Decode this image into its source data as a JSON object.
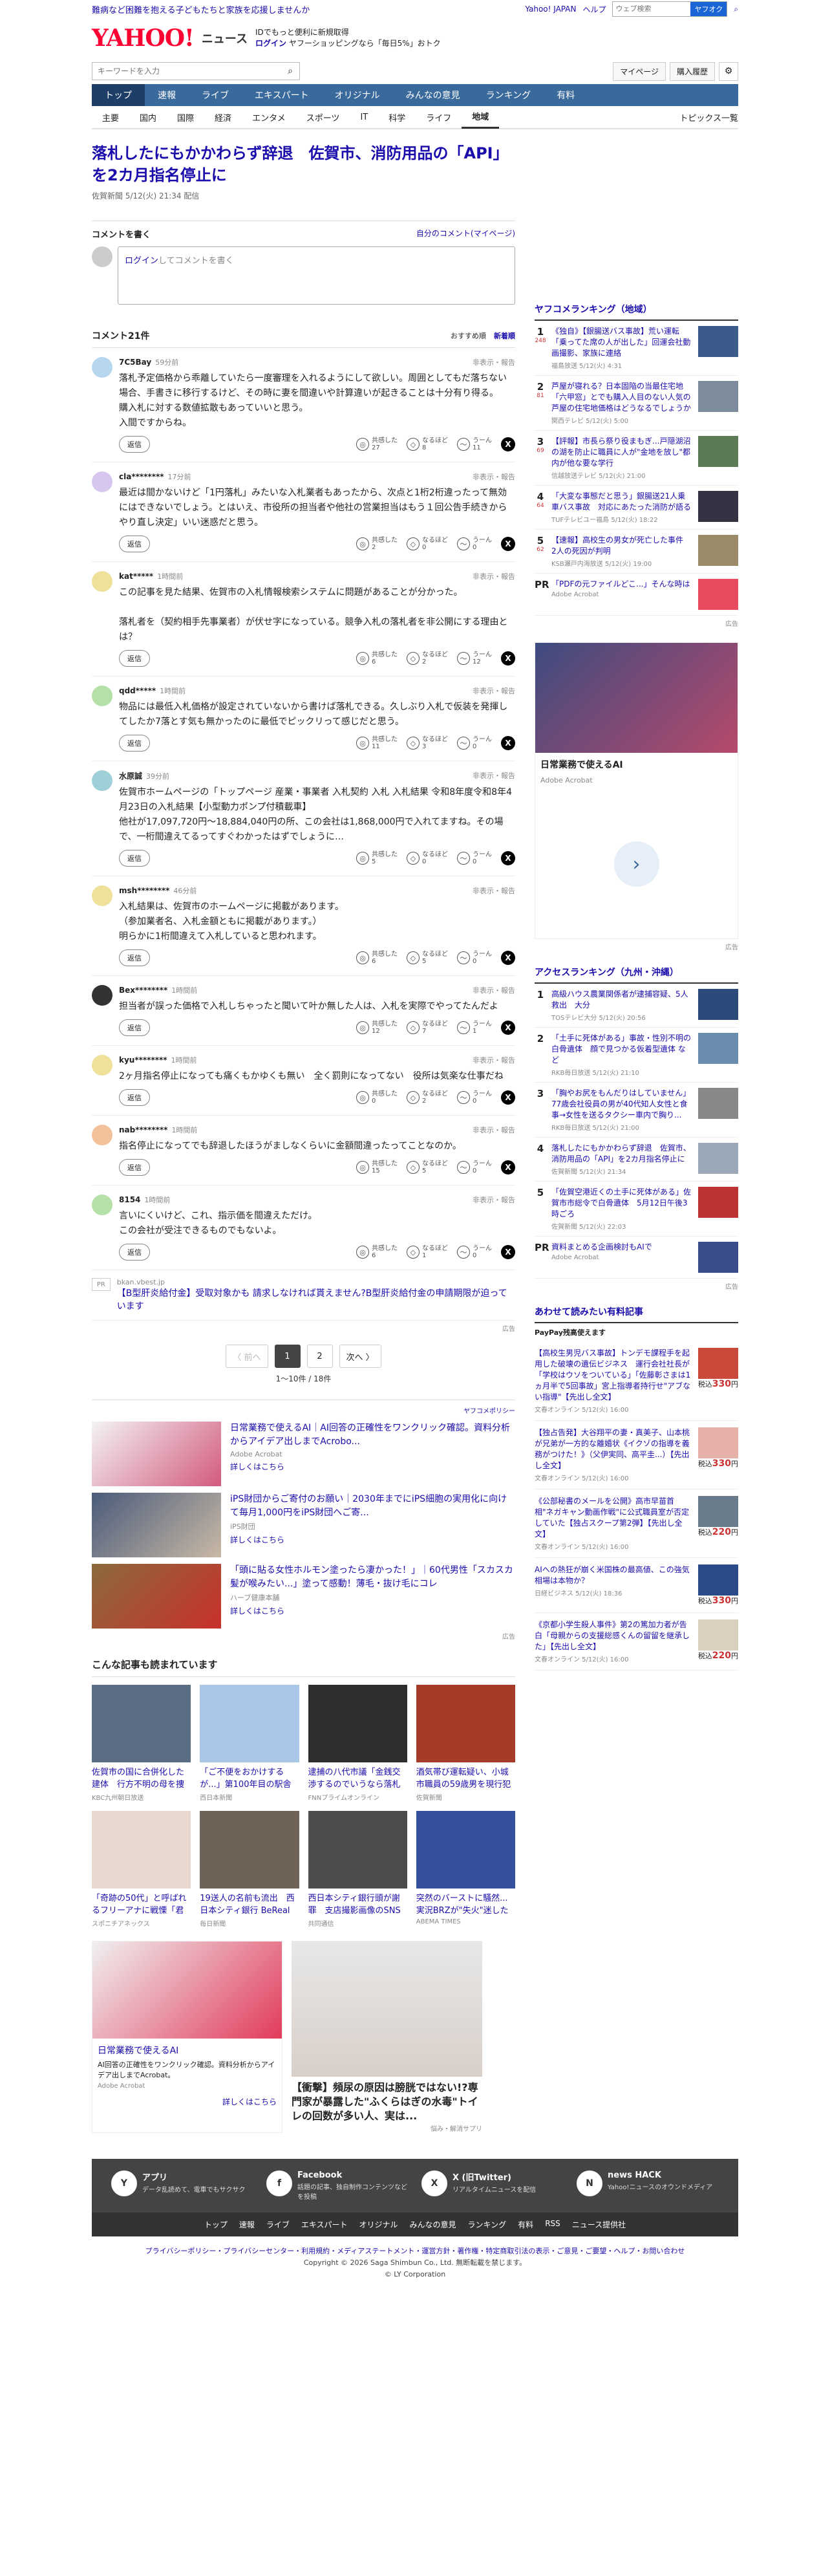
{
  "topbar": {
    "promo": "難病など困難を抱える子どもたちと家族を応援しませんか",
    "links": [
      "Yahoo! JAPAN",
      "ヘルプ"
    ],
    "search_placeholder": "ウェブ検索",
    "search_label": "ヤフオク"
  },
  "logo": {
    "brand": "YAHOO!",
    "sub": "ニュース",
    "line1": "IDでもっと便利に新規取得",
    "login": "ログイン",
    "line2": "ヤフーショッピングなら「毎日5%」おトク"
  },
  "search": {
    "placeholder": "キーワードを入力",
    "mypage": "マイページ",
    "purchase": "購入履歴"
  },
  "gnav": [
    "トップ",
    "速報",
    "ライブ",
    "エキスパート",
    "オリジナル",
    "みんなの意見",
    "ランキング",
    "有料"
  ],
  "subnav": {
    "items": [
      "主要",
      "国内",
      "国際",
      "経済",
      "エンタメ",
      "スポーツ",
      "IT",
      "科学",
      "ライフ",
      "地域"
    ],
    "toplink": "トピックス一覧"
  },
  "article": {
    "title": "落札したにもかかわらず辞退　佐賀市、消防用品の「API」を2カ月指名停止に",
    "source": "佐賀新聞",
    "time": "5/12(火) 21:34 配信"
  },
  "comment_box": {
    "title": "コメントを書く",
    "mine": "自分のコメント(マイページ)",
    "login": "ログイン",
    "placeholder": "してコメントを書く"
  },
  "comments_head": {
    "title": "コメント21件",
    "sort1": "おすすめ順",
    "sort2": "新着順"
  },
  "reactions": [
    "共感した",
    "なるほど",
    "うーん"
  ],
  "comments": [
    {
      "user": "7C5Bay",
      "time": "59分前",
      "text": "落札予定価格から乖離していたら一度審理を入れるようにして欲しい。周囲としてもだ落ちない場合、手書きに移行するけど、その時に妻を間違いや計算違いが起きることは十分有り得る。\n購入札に対する数値拡散もあっていいと思う。\n入間ですからね。",
      "c1": "27",
      "c2": "8",
      "c3": "11",
      "color": "#b7d7ef"
    },
    {
      "user": "cla********",
      "time": "17分前",
      "text": "最近は間かないけど「1円落札」みたいな入札業者もあったから、次点と1桁2桁違ったって無効にはできないでしょう。とはいえ、市役所の担当者や他社の営業担当はもう１回公告手続きからやり直し決定」いい迷惑だと思う。",
      "c1": "2",
      "c2": "0",
      "c3": "0",
      "color": "#d7c7ef"
    },
    {
      "user": "kat*****",
      "time": "1時間前",
      "text": "この記事を見た結果、佐賀市の入札情報検索システムに問題があることが分かった。\n\n落札者を（契約相手先事業者）が伏せ字になっている。競争入札の落札者を非公開にする理由とは？",
      "c1": "6",
      "c2": "2",
      "c3": "12",
      "color": "#efe09a"
    },
    {
      "user": "qdd*****",
      "time": "1時間前",
      "text": "物品には最低入札価格が設定されていないから書けば落札できる。久しぶり入札で仮装を発揮してしたか7落とす気も無かったのに最低でピックリって感じだと思う。",
      "c1": "11",
      "c2": "3",
      "c3": "0",
      "color": "#b5e0a8"
    },
    {
      "user": "水原誠",
      "time": "39分前",
      "text": "佐賀市ホームページの「トップページ 産業・事業者 入札契約 入札 入札結果 令和8年度令和8年4月23日の入札結果【小型動力ポンプ付積載車】\n他社が17,097,720円〜18,884,040円の所、この会社は1,868,000円で入れてますね。その場で、一桁間違えてるってすぐわかったはずでしょうに…",
      "c1": "5",
      "c2": "0",
      "c3": "0",
      "color": "#9fd0d8"
    },
    {
      "user": "msh********",
      "time": "46分前",
      "text": "入札結果は、佐賀市のホームページに掲載があります。\n（参加業者名、入札金額ともに掲載があります。）\n明らかに1桁間違えて入札していると思われます。",
      "c1": "6",
      "c2": "5",
      "c3": "0",
      "color": "#efe09a"
    },
    {
      "user": "Bex********",
      "time": "1時間前",
      "text": "担当者が誤った価格で入札しちゃったと聞いて叶か無した人は、入札を実際でやってたんだよ",
      "c1": "12",
      "c2": "7",
      "c3": "1",
      "color": "#333333"
    },
    {
      "user": "kyu********",
      "time": "1時間前",
      "text": "2ヶ月指名停止になっても痛くもかゆくも無い　全く罰則になってない　役所は気楽な仕事だね",
      "c1": "0",
      "c2": "2",
      "c3": "0",
      "color": "#efe09a"
    },
    {
      "user": "nab********",
      "time": "1時間前",
      "text": "指名停止になってでも辞退したほうがましなくらいに金額間違ったってことなのか。",
      "c1": "15",
      "c2": "5",
      "c3": "0",
      "color": "#f3c29c"
    },
    {
      "user": "8154",
      "time": "1時間前",
      "text": "言いにくいけど、これ、指示価を間違えただけ。\nこの会社が受注できるものでもないよ。",
      "c1": "6",
      "c2": "1",
      "c3": "0",
      "color": "#b5e0a8"
    }
  ],
  "reply_label": "返信",
  "report_label": "非表示・報告",
  "pr_comment": {
    "tag": "PR",
    "src": "bkan.vbest.jp",
    "text": "【B型肝炎給付金】受取対象かも 請求しなければ貰えません?B型肝炎給付金の申請期限が迫っています"
  },
  "ad_tag": "広告",
  "pager": {
    "prev": "〈 前へ",
    "pages": [
      "1",
      "2"
    ],
    "next": "次へ 〉",
    "info": "1〜10件 / 18件"
  },
  "ads": {
    "policy": "ヤフコメポリシー",
    "items": [
      {
        "title": "日常業務で使えるAI｜AI回答の正確性をワンクリック確認。資料分析からアイデア出しまでAcrobo...",
        "src": "Adobe Acrobat",
        "more": "詳しくはこちら"
      },
      {
        "title": "iPS財団からご寄付のお願い｜2030年までにiPS細胞の実用化に向けて毎月1,000円をiPS財団へご寄...",
        "src": "iPS財団",
        "more": "詳しくはこちら"
      },
      {
        "title": "「頭に貼る女性ホルモン塗ったら凄かった！」｜60代男性「スカスカ髪が喉みたい...」塗って感動！薄毛・抜け毛にコレ",
        "src": "ハーブ健康本舗",
        "more": "詳しくはこちら"
      }
    ]
  },
  "read_also": {
    "title": "こんな記事も読まれています",
    "items": [
      {
        "title": "佐賀市の国に合併化した建体　行方不明の母を捜索中",
        "src": "KBC九州朝日放送"
      },
      {
        "title": "「ご不便をおかけするが...」第100年目の駅舎が利用中止に　老...",
        "src": "西日本新聞"
      },
      {
        "title": "逮捕の八代市議「金銭交渉するのでいうなら落札して」行き違め...",
        "src": "FNNプライムオンライン"
      },
      {
        "title": "酒気帯び運転疑い、小城市職員の59歳男を現行犯逮捕　佐賀市の...",
        "src": "佐賀新聞"
      },
      {
        "title": "「奇跡の50代」と呼ばれるフリーアナに戦慄「君なるような、だん...",
        "src": "スポニチアネックス"
      },
      {
        "title": "19送人の名前も流出　西日本シティ銀行 BeReal 投稿問題",
        "src": "毎日新聞"
      },
      {
        "title": "西日本シティ銀行頭が謝罪　支店撮影画像のSNS拡散",
        "src": "共同通信"
      },
      {
        "title": "突然のバーストに騒然...実況BRZが\"失火\"迷した事態を「重...",
        "src": "ABEMA TIMES"
      }
    ]
  },
  "bottom_ads": {
    "a1_title": "日常業務で使えるAI",
    "a1_desc": "AI回答の正確性をワンクリック確認。資料分析からアイデア出しまでAcrobat。",
    "a1_src": "Adobe Acrobat",
    "a1_more": "詳しくはこちら",
    "a2_title": "【衝撃】頻尿の原因は膀胱ではない!?専門家が暴露した\"ふくらはぎの水毒\"トイレの回数が多い人、実は...",
    "a2_src": "悩み・解消サプリ"
  },
  "side": {
    "rank_title": "ヤフコメランキング（地域）",
    "rank": [
      {
        "n": "1",
        "c": "248",
        "t": "《独自》【銀腸送バス事故】荒い運転「乗ってた席の人が出した」回運会社動画撮影、家族に連絡",
        "src": "福島放送 5/12(火) 4:31"
      },
      {
        "n": "2",
        "c": "81",
        "t": "芦屋が寝れる？日本固陥の当最住宅地「六甲窓」とでも購入人目のない人気の芦屋の住宅地価格はどうなるでしょうか",
        "src": "関西テレビ 5/12(火) 5:00"
      },
      {
        "n": "3",
        "c": "69",
        "t": "【評報】市長ら祭り役まもぎ...戸隠湖沼の湖を防止に職員に人が\"金地を放し\"都内が他な要な学行",
        "src": "信越放送テレビ 5/12(火) 21:00"
      },
      {
        "n": "4",
        "c": "64",
        "t": "「大変な事態だと思う」銀腸送21人乗車バス事故　対応にあたった消防が語る",
        "src": "TUFテレビユー福島 5/12(火) 18:22"
      },
      {
        "n": "5",
        "c": "62",
        "t": "【速報】高校生の男女が死亡した事件　2人の死因が判明",
        "src": "KSB瀬戸内海放送 5/12(火) 19:00"
      }
    ],
    "pr_title": "「PDFの元ファイルどこ...」そんな時は",
    "pr_src": "Adobe Acrobat",
    "bigad_title": "日常業務で使えるAI",
    "bigad_src": "Adobe Acrobat",
    "access_title": "アクセスランキング（九州・沖縄）",
    "access": [
      {
        "n": "1",
        "t": "高級ハウス農業関係者が逮捕容疑、5人救出　大分",
        "src": "TOSテレビ大分 5/12(火) 20:56"
      },
      {
        "n": "2",
        "t": "「土手に死体がある」事故・性別不明の白骨遺体　顔で見つかる仮着型遺体 など",
        "src": "RKB毎日放送 5/12(火) 21:10"
      },
      {
        "n": "3",
        "t": "「胸やお尻をもんだりはしていません」77歳会社役員の男が40代知人女性と食事→女性を送るタクシー車内で胸り...",
        "src": "RKB毎日放送 5/12(火) 21:00"
      },
      {
        "n": "4",
        "t": "落札したにもかかわらず辞退　佐賀市、消防用品の「API」を2カ月指名停止に",
        "src": "佐賀新聞 5/12(火) 21:34"
      },
      {
        "n": "5",
        "t": "「佐賀空港近くの土手に死体がある」佐賀市市総令で白骨遺体　5月12日午後3時ごろ",
        "src": "佐賀新聞 5/12(火) 22:03"
      }
    ],
    "access_pr": "資料まとめる企画検討もAIで",
    "access_pr_src": "Adobe Acrobat",
    "products_title": "あわせて読みたい有料記事",
    "products_brand": "PayPay残高使えます",
    "products": [
      {
        "t": "【高校生男児バス事故】トンデモ課程手を起用した破壊の遺伝ビジネス　運行会社社長が「学校はウソをついている」「佐藤彰さまは1ヵ月半で5回事故」宮上指導者持行せ\"アブない指導\"【先出し全文】",
        "src": "文春オンライン 5/12(火) 16:00",
        "p": "330"
      },
      {
        "t": "【独占告発】大谷翔平の妻・真美子、山本桃が兄弟が一方的な離婚状《イクゾの指導を義務がつけた！》（父伊実同、高平圭...）【先出し全文】",
        "src": "文春オンライン 5/12(火) 16:00",
        "p": "330"
      },
      {
        "t": "《公部秘書のメールを公開》高市早苗首相\"ネガキャン動画作戦\"に公式職員室が否定していた【独占スクープ第2弾】【先出し全文】",
        "src": "文春オンライン 5/12(火) 16:00",
        "p": "220"
      },
      {
        "t": "AIへの熱狂が崩く米国株の最高値、この強気相場は本物か？",
        "src": "日経ビジネス 5/12(火) 18:36",
        "p": "330"
      },
      {
        "t": "《京都小学生殺人事件》第2の篤加力者が告白「母親からの支援総感くんの留留を継承した」【先出し全文】",
        "src": "文春オンライン 5/12(火) 16:00",
        "p": "220"
      }
    ],
    "price_prefix": "税込",
    "price_suffix": "円"
  },
  "footer": {
    "apps": [
      {
        "t": "アプリ",
        "d": "データ乱読めて、電車でもサクサク",
        "ic": "Y"
      },
      {
        "t": "Facebook",
        "d": "話題の記事、独自制作コンテンツなどを投稿",
        "ic": "f"
      },
      {
        "t": "X (旧Twitter)",
        "d": "リアルタイムニュースを配信",
        "ic": "X"
      },
      {
        "t": "news HACK",
        "d": "Yahoo!ニュースのオウンドメディア",
        "ic": "N"
      }
    ],
    "nav": [
      "トップ",
      "速報",
      "ライブ",
      "エキスパート",
      "オリジナル",
      "みんなの意見",
      "ランキング",
      "有料",
      "RSS",
      "ニュース提供社"
    ],
    "legal_links": "プライバシーポリシー・プライバシーセンター・利用規約・メディアステートメント・運営方針・著作権・特定商取引法の表示・ご意見・ご要望・ヘルプ・お問い合わせ",
    "copyright1": "Copyright © 2026 Saga Shimbun Co., Ltd. 無断転載を禁じます。",
    "copyright2": "© LY Corporation"
  }
}
